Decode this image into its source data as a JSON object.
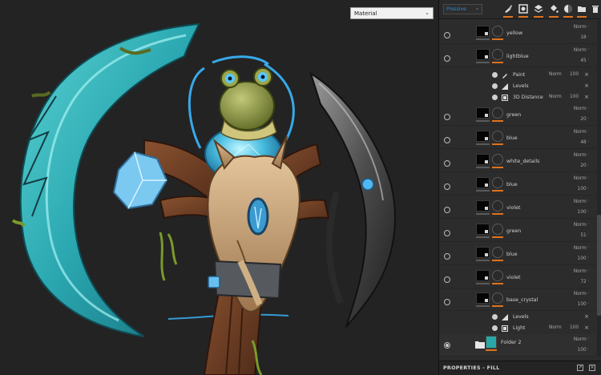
{
  "viewport": {
    "material_select": {
      "value": "Material"
    }
  },
  "toolbar": {
    "preset": "Pressive",
    "icons": [
      "paint-brush-icon",
      "add-fill-icon",
      "add-layer-icon",
      "bucket-icon",
      "effects-icon",
      "folder-icon",
      "delete-icon"
    ]
  },
  "layers": [
    {
      "kind": "layer",
      "name": "yellow",
      "blend": "Norm",
      "opacity": "18",
      "visible": false
    },
    {
      "kind": "layer",
      "name": "lightblue",
      "blend": "Norm",
      "opacity": "45",
      "visible": false
    },
    {
      "kind": "effect",
      "name": "Paint",
      "icon": "brush-icon",
      "blend": "Norm",
      "opacity": "100"
    },
    {
      "kind": "effect",
      "name": "Levels",
      "icon": "levels-icon",
      "blend": "",
      "opacity": ""
    },
    {
      "kind": "effect",
      "name": "3D Distance",
      "icon": "generator-icon",
      "blend": "Norm",
      "opacity": "100"
    },
    {
      "kind": "layer",
      "name": "green",
      "blend": "Norm",
      "opacity": "20",
      "visible": false
    },
    {
      "kind": "layer",
      "name": "blue",
      "blend": "Norm",
      "opacity": "48",
      "visible": false
    },
    {
      "kind": "layer",
      "name": "white_details",
      "blend": "Norm",
      "opacity": "20",
      "visible": false
    },
    {
      "kind": "layer",
      "name": "blue",
      "blend": "Norm",
      "opacity": "100",
      "visible": false
    },
    {
      "kind": "layer",
      "name": "violet",
      "blend": "Norm",
      "opacity": "100",
      "visible": false
    },
    {
      "kind": "layer",
      "name": "green",
      "blend": "Norm",
      "opacity": "51",
      "visible": false
    },
    {
      "kind": "layer",
      "name": "blue",
      "blend": "Norm",
      "opacity": "100",
      "visible": false
    },
    {
      "kind": "layer",
      "name": "violet",
      "blend": "Norm",
      "opacity": "72",
      "visible": false
    },
    {
      "kind": "layer",
      "name": "base_crystal",
      "blend": "Norm",
      "opacity": "100",
      "visible": false
    },
    {
      "kind": "effect",
      "name": "Levels",
      "icon": "levels-icon",
      "blend": "",
      "opacity": ""
    },
    {
      "kind": "effect",
      "name": "Light",
      "icon": "generator-icon",
      "blend": "Norm",
      "opacity": "100"
    },
    {
      "kind": "folder",
      "name": "Folder 2",
      "blend": "Norm",
      "opacity": "100",
      "visible": true
    }
  ],
  "properties": {
    "title": "PROPERTIES - FILL"
  },
  "colors": {
    "accent": "#e0721d",
    "link": "#2b8cd6",
    "crystal": "#3fb9c9",
    "wood": "#6d3b22",
    "bone": "#caa57a"
  }
}
